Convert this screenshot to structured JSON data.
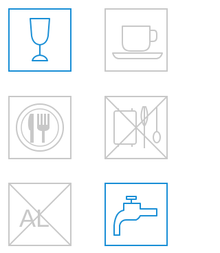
{
  "colors": {
    "active": "#1a8fd6",
    "inactive": "#c8c8c8"
  },
  "tiles": [
    {
      "icon": "wine-glass-icon",
      "state": "allowed",
      "active": true
    },
    {
      "icon": "coffee-cup-icon",
      "state": "allowed",
      "active": false
    },
    {
      "icon": "plate-fork-knife-icon",
      "state": "allowed",
      "active": false
    },
    {
      "icon": "kitchen-utensils-icon",
      "state": "crossed-out",
      "active": false
    },
    {
      "icon": "aluminium-icon",
      "state": "crossed-out",
      "active": false,
      "label": "AL"
    },
    {
      "icon": "water-tap-icon",
      "state": "allowed",
      "active": true
    }
  ]
}
